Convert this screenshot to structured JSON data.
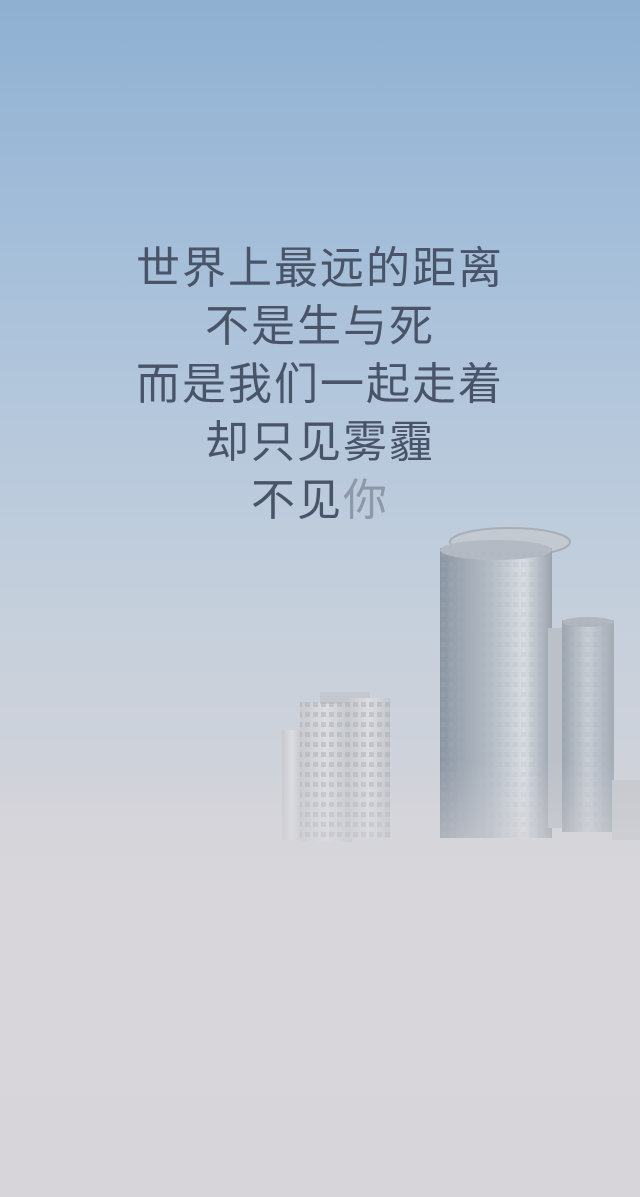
{
  "poem": {
    "lines": [
      "世界上最远的距离",
      "不是生与死",
      "而是我们一起走着",
      "却只见雾霾"
    ],
    "last_line_prefix": "不见",
    "last_line_faded": "你"
  },
  "colors": {
    "sky_top": "#8fb0d2",
    "fog": "#d8d6db",
    "text": "#4a5468"
  }
}
